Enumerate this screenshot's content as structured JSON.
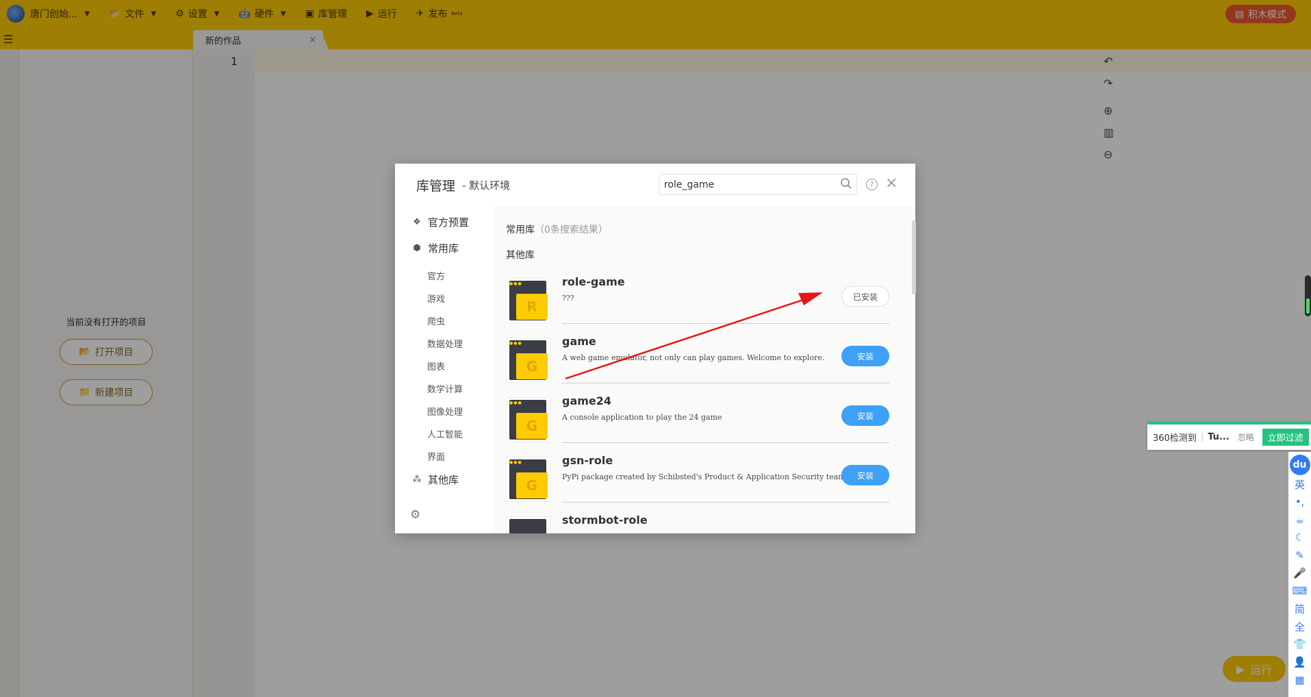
{
  "topbar": {
    "user_label": "唐门创始...",
    "file_label": "文件",
    "settings_label": "设置",
    "hardware_label": "硬件",
    "libmgr_label": "库管理",
    "run_label": "运行",
    "publish_label": "发布",
    "publish_badge": "Beta",
    "blocks_mode_label": "积木模式"
  },
  "tab": {
    "title": "新的作品",
    "close": "×"
  },
  "projects": {
    "empty_text": "当前没有打开的项目",
    "open_label": "打开项目",
    "new_label": "新建项目"
  },
  "editor": {
    "line_number": "1",
    "run_label": "运行"
  },
  "dialog": {
    "title": "库管理",
    "subtitle": "- 默认环境",
    "search_value": "role_game",
    "close": "×",
    "help": "?",
    "sidebar": {
      "official_preset": "官方预置",
      "common_libs": "常用库",
      "sub_items": [
        "官方",
        "游戏",
        "爬虫",
        "数据处理",
        "图表",
        "数学计算",
        "图像处理",
        "人工智能",
        "界面"
      ],
      "other_libs": "其他库"
    },
    "sections": {
      "common": "常用库",
      "common_count": "（0条搜索结果）",
      "other": "其他库"
    },
    "packages": [
      {
        "letter": "R",
        "name": "role-game",
        "desc": "???",
        "action": "已安装",
        "installed": true
      },
      {
        "letter": "G",
        "name": "game",
        "desc": "A web game emulator, not only can play games. Welcome to explore.",
        "action": "安装",
        "installed": false
      },
      {
        "letter": "G",
        "name": "game24",
        "desc": "A console application to play the 24 game",
        "action": "安装",
        "installed": false
      },
      {
        "letter": "G",
        "name": "gsn-role",
        "desc": "PyPi package created by Schibsted's Product & Application Security team.",
        "action": "安装",
        "installed": false
      },
      {
        "letter": "",
        "name": "stormbot-role",
        "desc": "",
        "action": "",
        "installed": false
      }
    ]
  },
  "notice": {
    "text": "360检测到",
    "bold": "Tu...",
    "ignore": "忽略",
    "filter": "立即过滤"
  },
  "ime": {
    "logo": "du",
    "items": [
      "英",
      "•,",
      "☕",
      "☾",
      "✎",
      "🎤",
      "⌨",
      "简",
      "全",
      "👕",
      "👤",
      "▦"
    ]
  },
  "colors": {
    "brand_yellow": "#ffcb05",
    "install_blue": "#3ea0f7",
    "arrow_red": "#e8141a",
    "accent_green": "#26c281"
  }
}
